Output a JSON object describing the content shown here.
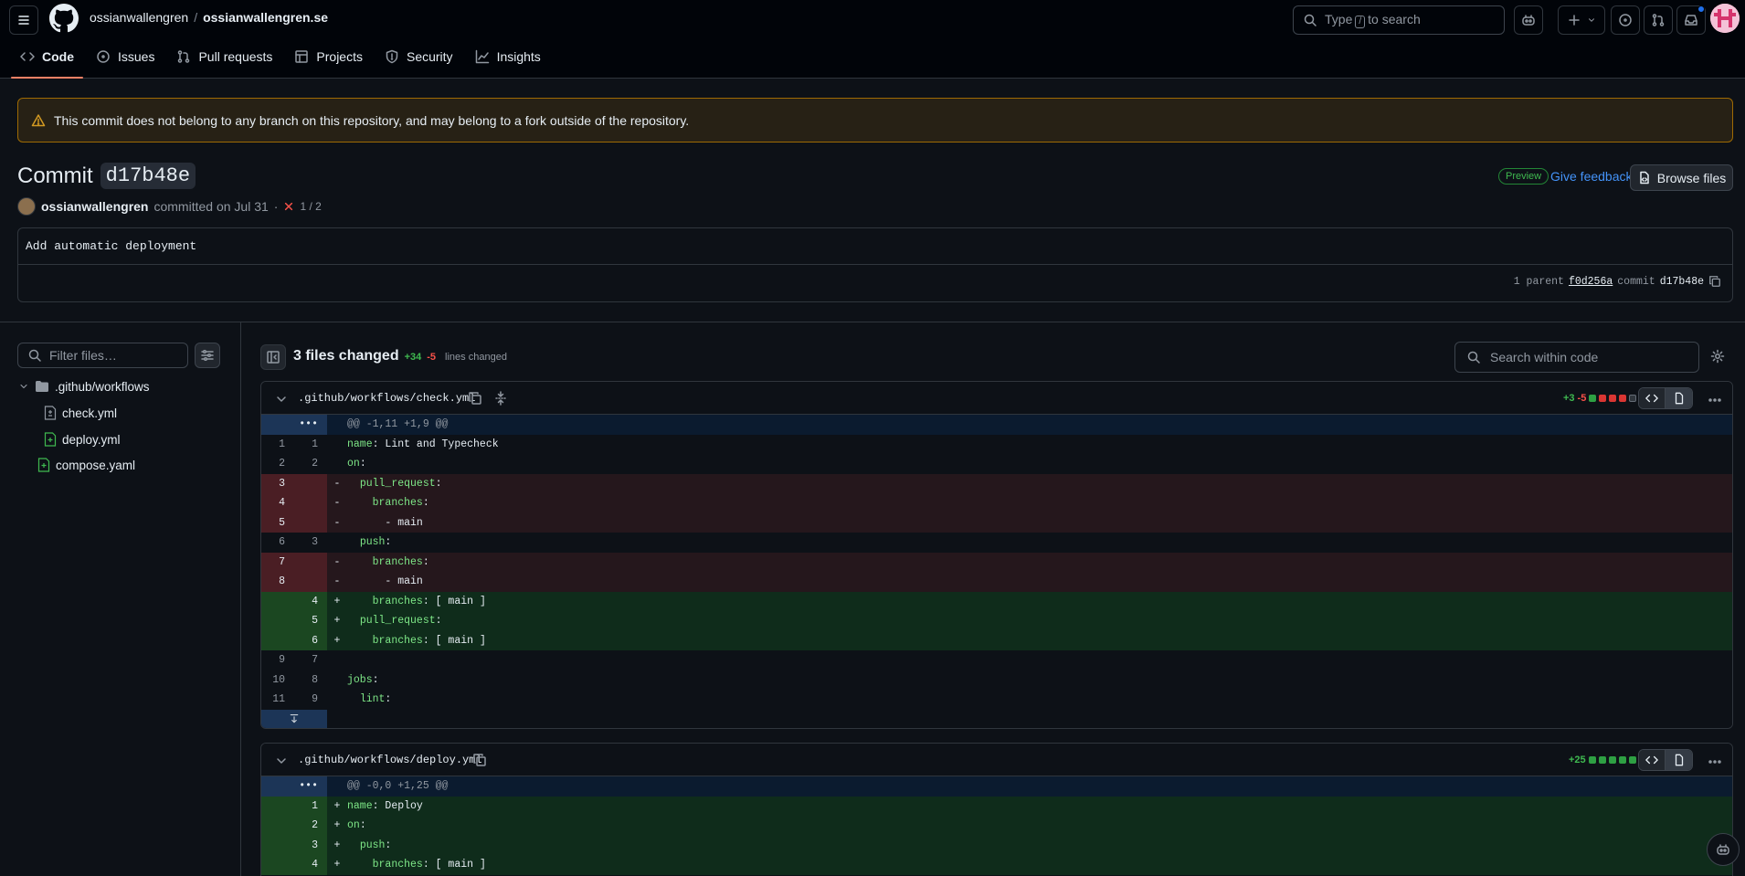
{
  "header": {
    "owner": "ossianwallengren",
    "separator": "/",
    "repo": "ossianwallengren.se",
    "search_prefix": "Type",
    "search_key": "/",
    "search_suffix": "to search"
  },
  "tabs": [
    {
      "label": "Code",
      "icon": "code-icon",
      "active": true
    },
    {
      "label": "Issues",
      "icon": "issue-icon"
    },
    {
      "label": "Pull requests",
      "icon": "pull-request-icon"
    },
    {
      "label": "Projects",
      "icon": "table-icon"
    },
    {
      "label": "Security",
      "icon": "shield-icon"
    },
    {
      "label": "Insights",
      "icon": "graph-icon"
    }
  ],
  "banner": {
    "text": "This commit does not belong to any branch on this repository, and may belong to a fork outside of the repository."
  },
  "commit": {
    "title_prefix": "Commit",
    "sha": "d17b48e",
    "author": "ossianwallengren",
    "committed_text": "committed on Jul 31",
    "dot": "·",
    "checks": "1 / 2",
    "message": "Add automatic deployment",
    "parent_count": "1 parent",
    "parent_sha": "f0d256a",
    "commit_label": "commit",
    "full_sha_short": "d17b48e"
  },
  "actions": {
    "preview": "Preview",
    "feedback": "Give feedback",
    "browse": "Browse files"
  },
  "tree": {
    "filter_placeholder": "Filter files…",
    "folder": ".github/workflows",
    "files": [
      "check.yml",
      "deploy.yml"
    ],
    "root_file": "compose.yaml"
  },
  "summary": {
    "files_changed": "3 files changed",
    "additions": "+34",
    "deletions": "-5",
    "lines_changed": "lines changed",
    "search_placeholder": "Search within code"
  },
  "file1": {
    "name": ".github/workflows/check.yml",
    "additions": "+3",
    "deletions": "-5",
    "hunk": "@@ -1,11 +1,9 @@",
    "expand_dots": "•••",
    "lines": [
      {
        "t": "ctx",
        "o": "1",
        "n": "1",
        "s": "",
        "key": "name",
        "rest": ": Lint and Typecheck"
      },
      {
        "t": "ctx",
        "o": "2",
        "n": "2",
        "s": "",
        "key": "on",
        "rest": ":"
      },
      {
        "t": "del",
        "o": "3",
        "n": "",
        "s": "-",
        "pre": "  ",
        "key": "pull_request",
        "rest": ":"
      },
      {
        "t": "del",
        "o": "4",
        "n": "",
        "s": "-",
        "pre": "    ",
        "key": "branches",
        "rest": ":"
      },
      {
        "t": "del",
        "o": "5",
        "n": "",
        "s": "-",
        "pre": "      ",
        "key": "",
        "rest": "- main"
      },
      {
        "t": "ctx",
        "o": "6",
        "n": "3",
        "s": "",
        "pre": "  ",
        "key": "push",
        "rest": ":"
      },
      {
        "t": "del",
        "o": "7",
        "n": "",
        "s": "-",
        "pre": "    ",
        "key": "branches",
        "rest": ":"
      },
      {
        "t": "del",
        "o": "8",
        "n": "",
        "s": "-",
        "pre": "      ",
        "key": "",
        "rest": "- main"
      },
      {
        "t": "add",
        "o": "",
        "n": "4",
        "s": "+",
        "pre": "    ",
        "key": "branches",
        "rest": ": [ main ]"
      },
      {
        "t": "add",
        "o": "",
        "n": "5",
        "s": "+",
        "pre": "  ",
        "key": "pull_request",
        "rest": ":"
      },
      {
        "t": "add",
        "o": "",
        "n": "6",
        "s": "+",
        "pre": "    ",
        "key": "branches",
        "rest": ": [ main ]"
      },
      {
        "t": "ctx",
        "o": "9",
        "n": "7",
        "s": "",
        "key": "",
        "rest": ""
      },
      {
        "t": "ctx",
        "o": "10",
        "n": "8",
        "s": "",
        "key": "jobs",
        "rest": ":"
      },
      {
        "t": "ctx",
        "o": "11",
        "n": "9",
        "s": "",
        "pre": "  ",
        "key": "lint",
        "rest": ":"
      }
    ]
  },
  "file2": {
    "name": ".github/workflows/deploy.yml",
    "additions": "+25",
    "hunk": "@@ -0,0 +1,25 @@",
    "expand_dots": "•••",
    "lines": [
      {
        "t": "add",
        "o": "",
        "n": "1",
        "s": "+",
        "key": "name",
        "rest": ": Deploy"
      },
      {
        "t": "add",
        "o": "",
        "n": "2",
        "s": "+",
        "key": "on",
        "rest": ":"
      },
      {
        "t": "add",
        "o": "",
        "n": "3",
        "s": "+",
        "pre": "  ",
        "key": "push",
        "rest": ":"
      },
      {
        "t": "add",
        "o": "",
        "n": "4",
        "s": "+",
        "pre": "    ",
        "key": "branches",
        "rest": ": [ main ]"
      }
    ]
  }
}
